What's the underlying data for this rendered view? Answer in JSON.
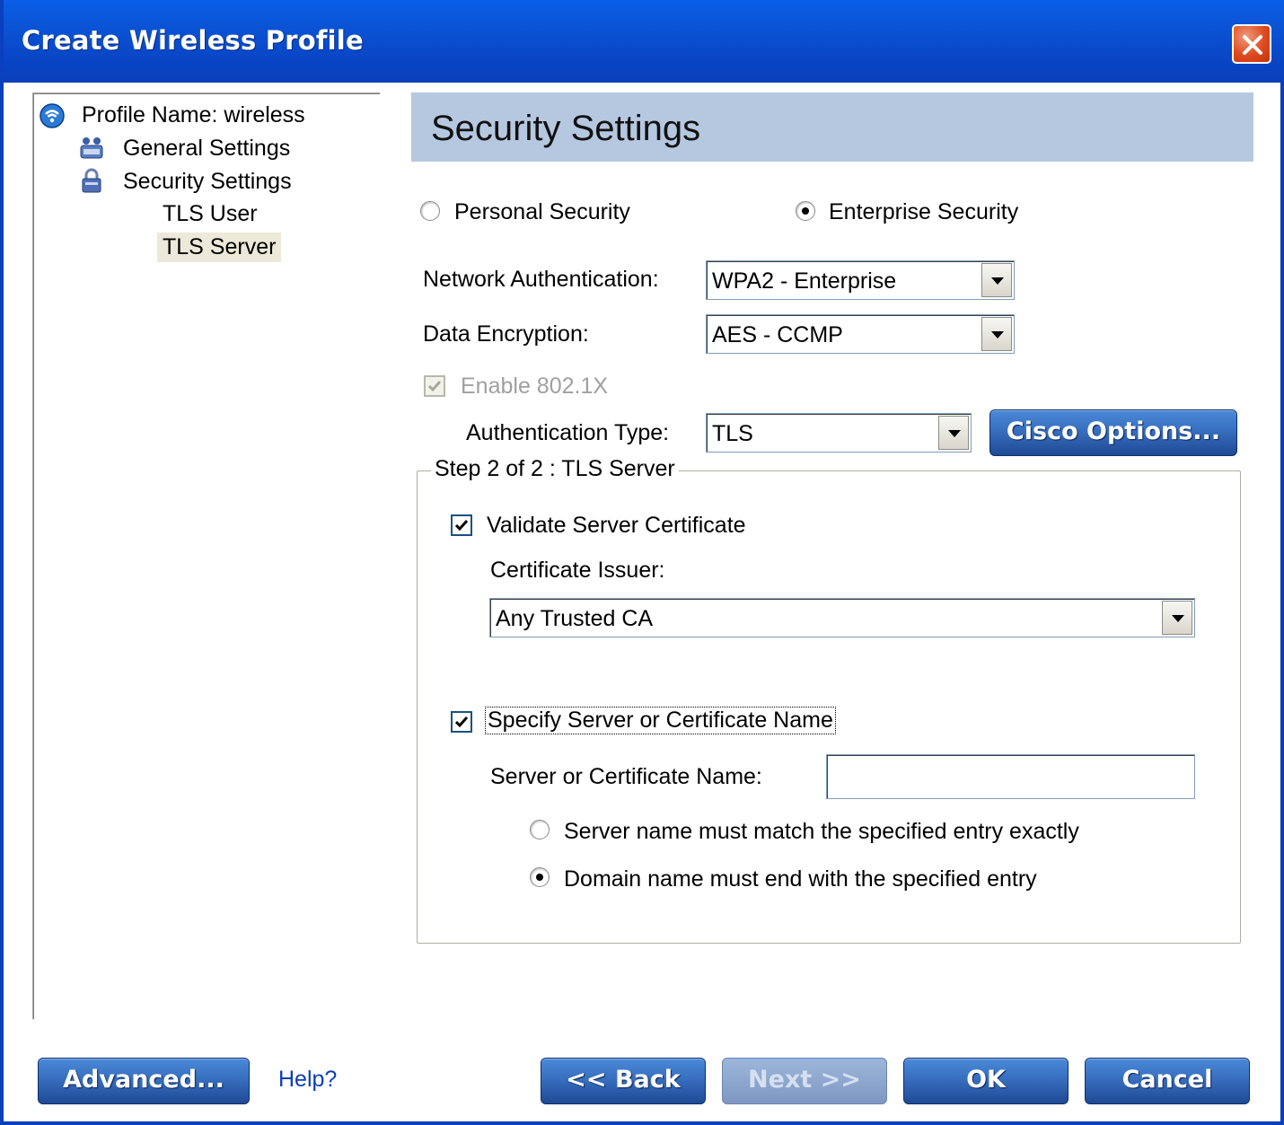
{
  "window": {
    "title": "Create Wireless Profile"
  },
  "tree": {
    "root": "Profile Name: wireless",
    "items": [
      {
        "label": "General Settings",
        "icon": "users-icon"
      },
      {
        "label": "Security Settings",
        "icon": "lock-icon"
      },
      {
        "label": "TLS User"
      },
      {
        "label": "TLS Server",
        "selected": true
      }
    ]
  },
  "panel": {
    "title": "Security Settings",
    "personal_security": "Personal Security",
    "enterprise_security": "Enterprise Security",
    "security_mode": "Enterprise Security",
    "network_auth_label": "Network Authentication:",
    "network_auth_value": "WPA2 - Enterprise",
    "data_encryption_label": "Data Encryption:",
    "data_encryption_value": "AES - CCMP",
    "enable_8021x_label": "Enable 802.1X",
    "enable_8021x_checked": true,
    "auth_type_label": "Authentication Type:",
    "auth_type_value": "TLS",
    "cisco_options_label": "Cisco Options..."
  },
  "group": {
    "title": "Step 2 of 2 : TLS Server",
    "validate_label": "Validate Server Certificate",
    "validate_checked": true,
    "issuer_label": "Certificate Issuer:",
    "issuer_value": "Any Trusted CA",
    "specify_label": "Specify Server or Certificate Name",
    "specify_checked": true,
    "server_name_label": "Server or Certificate Name:",
    "server_name_value": "",
    "match_exact_label": "Server name must match the specified entry exactly",
    "domain_end_label": "Domain name must end with the specified entry",
    "match_mode": "Domain name must end with the specified entry"
  },
  "footer": {
    "advanced": "Advanced...",
    "help": "Help?",
    "back": "<< Back",
    "next": "Next >>",
    "ok": "OK",
    "cancel": "Cancel"
  },
  "colors": {
    "title_bar": "#0a54d6",
    "header_band": "#b5c8e0",
    "button": "#2a5aa8"
  }
}
